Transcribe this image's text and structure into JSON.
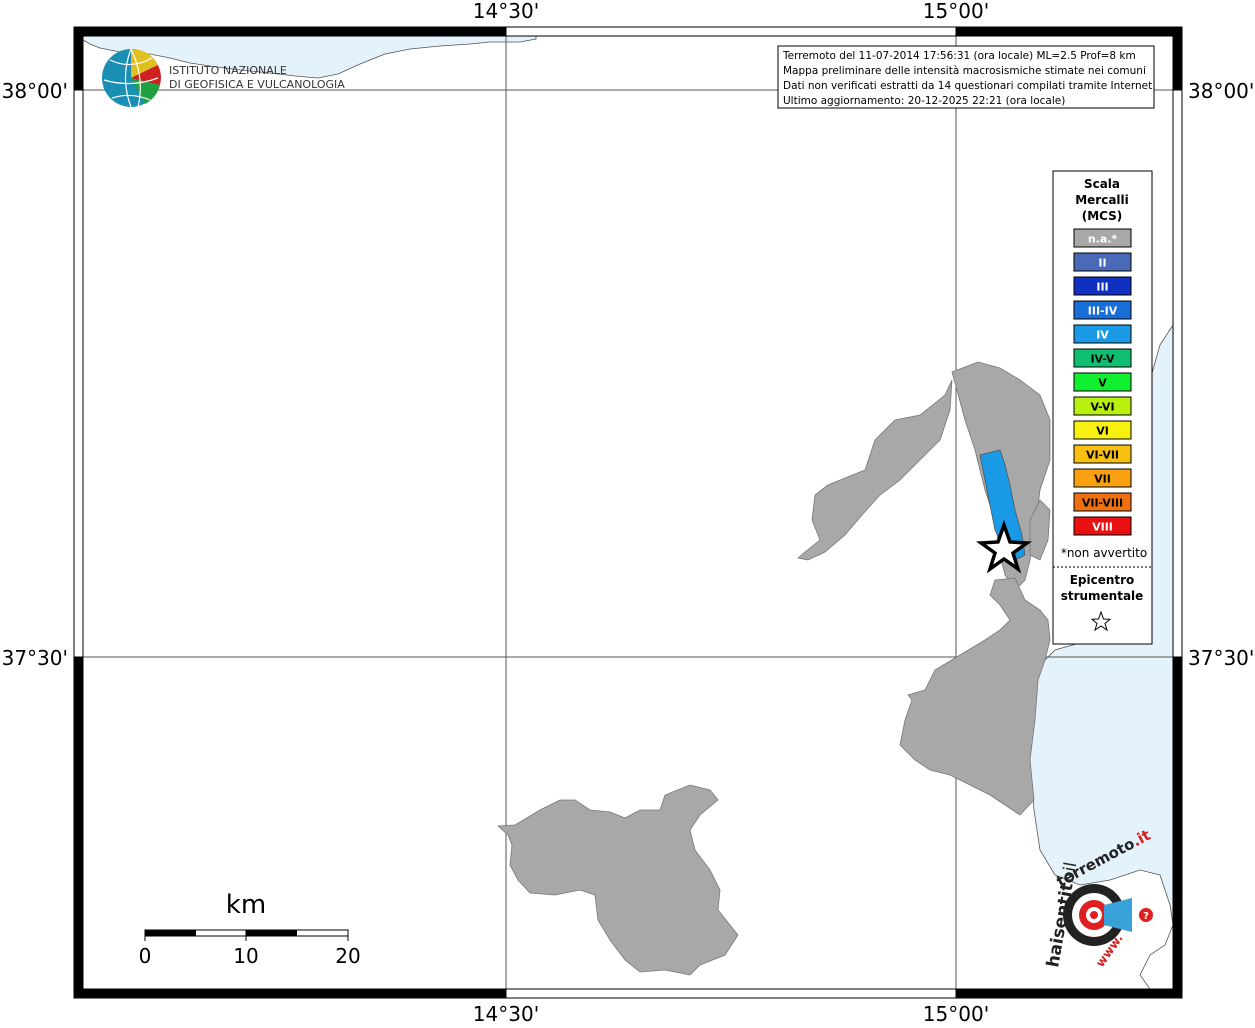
{
  "map": {
    "axis_labels": {
      "top_left": "14°30'",
      "top_right": "15°00'",
      "bottom_left": "14°30'",
      "bottom_right": "15°00'",
      "left_top": "38°00'",
      "left_bottom": "37°30'",
      "right_top": "38°00'",
      "right_bottom": "37°30'"
    },
    "colors": {
      "sea": "#e4f2fb",
      "land_gray": "#a8a8a8",
      "intensity_iv": "#1a9ae6",
      "frame": "#000000"
    }
  },
  "logo": {
    "line1": "ISTITUTO NAZIONALE",
    "line2": "DI GEOFISICA E VULCANOLOGIA"
  },
  "info": {
    "line1": "Terremoto del 11-07-2014 17:56:31 (ora locale) ML=2.5 Prof=8 km",
    "line2": "Mappa preliminare delle intensità macrosismiche stimate nei comuni",
    "line3": "Dati non verificati estratti da 14 questionari compilati tramite Internet.",
    "line4": "Ultimo aggiornamento: 20-12-2025 22:21 (ora locale)"
  },
  "legend": {
    "title1": "Scala",
    "title2": "Mercalli",
    "title3": "(MCS)",
    "items": [
      {
        "label": "n.a.*",
        "color": "#a8a8a8",
        "text": "#ffffff"
      },
      {
        "label": "II",
        "color": "#4a6ab8",
        "text": "#ffffff"
      },
      {
        "label": "III",
        "color": "#1030c0",
        "text": "#ffffff"
      },
      {
        "label": "III-IV",
        "color": "#1a6ed8",
        "text": "#ffffff"
      },
      {
        "label": "IV",
        "color": "#1a9ae6",
        "text": "#ffffff"
      },
      {
        "label": "IV-V",
        "color": "#10c070",
        "text": "#000000"
      },
      {
        "label": "V",
        "color": "#10f030",
        "text": "#000000"
      },
      {
        "label": "V-VI",
        "color": "#b8f010",
        "text": "#000000"
      },
      {
        "label": "VI",
        "color": "#f8f010",
        "text": "#000000"
      },
      {
        "label": "VI-VII",
        "color": "#f8c010",
        "text": "#000000"
      },
      {
        "label": "VII",
        "color": "#f8a010",
        "text": "#000000"
      },
      {
        "label": "VII-VIII",
        "color": "#f07010",
        "text": "#000000"
      },
      {
        "label": "VIII",
        "color": "#e81010",
        "text": "#ffffff"
      }
    ],
    "footnote": "*non avvertito",
    "epicenter1": "Epicentro",
    "epicenter2": "strumentale"
  },
  "scalebar": {
    "unit": "km",
    "ticks": [
      "0",
      "10",
      "20"
    ]
  },
  "hsit": {
    "prefix": "hai",
    "sentito": "sentito",
    "il": "il",
    "terremoto": "terremoto",
    "it": ".it",
    "www": "www."
  }
}
